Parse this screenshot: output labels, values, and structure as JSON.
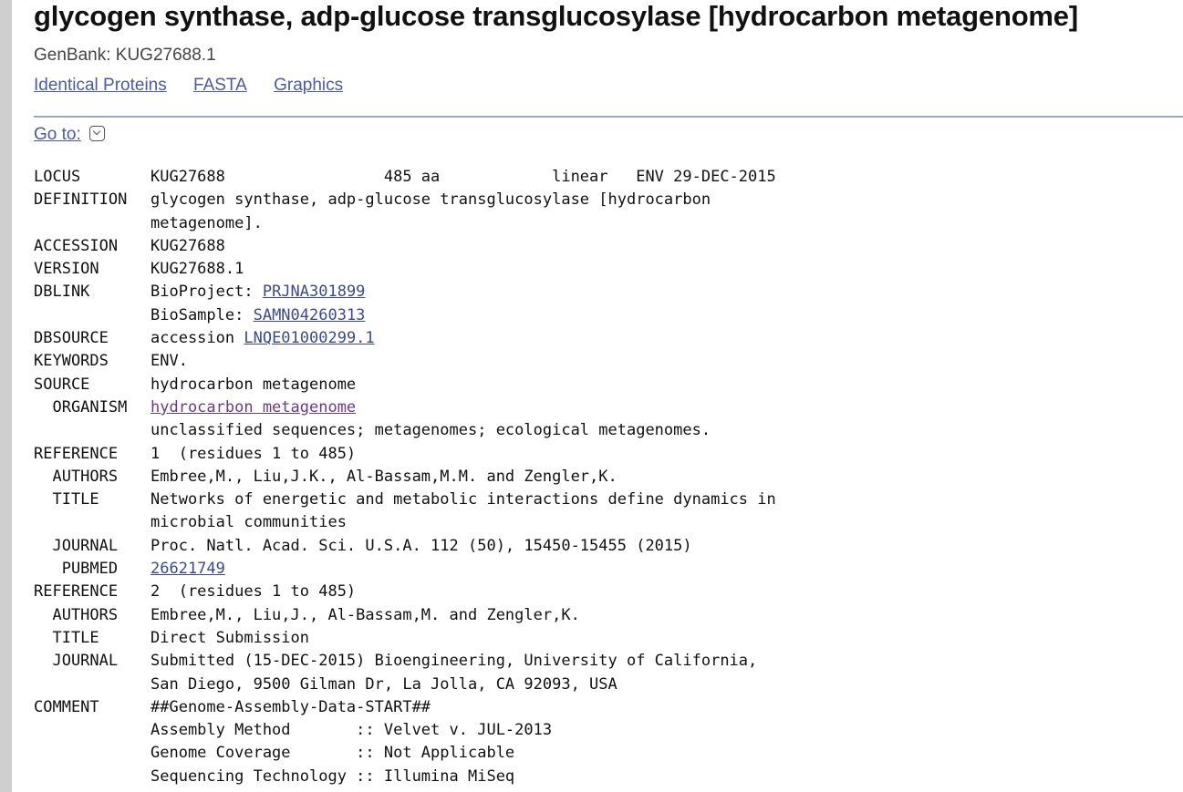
{
  "header": {
    "title": "glycogen synthase, adp-glucose transglucosylase [hydrocarbon metagenome]",
    "subtitle": "GenBank: KUG27688.1"
  },
  "links": [
    "Identical Proteins",
    "FASTA",
    "Graphics"
  ],
  "goto": {
    "label": "Go to:"
  },
  "record": {
    "locus": {
      "key": "LOCUS",
      "value": "KUG27688                 485 aa            linear   ENV 29-DEC-2015"
    },
    "definition": {
      "key": "DEFINITION",
      "line1": "glycogen synthase, adp-glucose transglucosylase [hydrocarbon",
      "line2": "metagenome]."
    },
    "accession": {
      "key": "ACCESSION",
      "value": "KUG27688"
    },
    "version": {
      "key": "VERSION",
      "value": "KUG27688.1"
    },
    "dblink": {
      "key": "DBLINK",
      "bioproject_prefix": "BioProject: ",
      "bioproject": "PRJNA301899",
      "biosample_prefix": "BioSample: ",
      "biosample": "SAMN04260313"
    },
    "dbsource": {
      "key": "DBSOURCE",
      "prefix": "accession ",
      "link": "LNQE01000299.1"
    },
    "keywords": {
      "key": "KEYWORDS",
      "value": "ENV."
    },
    "source": {
      "key": "SOURCE",
      "value": "hydrocarbon metagenome"
    },
    "organism": {
      "key": "  ORGANISM",
      "link": "hydrocarbon metagenome",
      "lineage": "unclassified sequences; metagenomes; ecological metagenomes."
    },
    "reference1": {
      "key": "REFERENCE",
      "value": "1  (residues 1 to 485)",
      "authors_key": "  AUTHORS",
      "authors": "Embree,M., Liu,J.K., Al-Bassam,M.M. and Zengler,K.",
      "title_key": "  TITLE",
      "title1": "Networks of energetic and metabolic interactions define dynamics in",
      "title2": "microbial communities",
      "journal_key": "  JOURNAL",
      "journal": "Proc. Natl. Acad. Sci. U.S.A. 112 (50), 15450-15455 (2015)",
      "pubmed_key": "   PUBMED",
      "pubmed": "26621749"
    },
    "reference2": {
      "key": "REFERENCE",
      "value": "2  (residues 1 to 485)",
      "authors_key": "  AUTHORS",
      "authors": "Embree,M., Liu,J., Al-Bassam,M. and Zengler,K.",
      "title_key": "  TITLE",
      "title": "Direct Submission",
      "journal_key": "  JOURNAL",
      "journal1": "Submitted (15-DEC-2015) Bioengineering, University of California,",
      "journal2": "San Diego, 9500 Gilman Dr, La Jolla, CA 92093, USA"
    },
    "comment": {
      "key": "COMMENT",
      "line1": "##Genome-Assembly-Data-START##",
      "line2": "Assembly Method       :: Velvet v. JUL-2013",
      "line3": "Genome Coverage       :: Not Applicable",
      "line4": "Sequencing Technology :: Illumina MiSeq"
    }
  }
}
